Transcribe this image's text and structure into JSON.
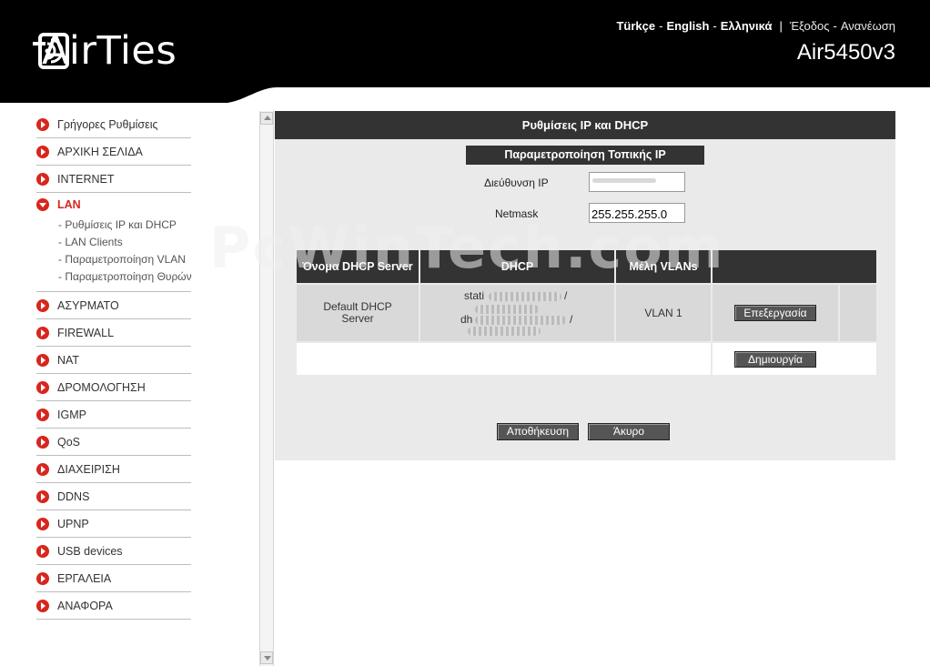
{
  "header": {
    "brand": "AirTies",
    "languages": [
      "Türkçe",
      "English",
      "Ελληνικά"
    ],
    "actions": [
      "Έξοδος",
      "Ανανέωση"
    ],
    "model": "Air5450v3"
  },
  "sidebar": {
    "items": [
      {
        "label": "Γρήγορες Ρυθμίσεις"
      },
      {
        "label": "ΑΡΧΙΚΗ ΣΕΛΙΔΑ"
      },
      {
        "label": "INTERNET"
      },
      {
        "label": "LAN",
        "active": true,
        "subitems": [
          "- Ρυθμίσεις IP και DHCP",
          "- LAN Clients",
          "- Παραμετροποίηση VLAN",
          "- Παραμετροποίηση Θυρών"
        ]
      },
      {
        "label": "ΑΣΥΡΜΑΤΟ"
      },
      {
        "label": "FIREWALL"
      },
      {
        "label": "NAT"
      },
      {
        "label": "ΔΡΟΜΟΛΟΓΗΣΗ"
      },
      {
        "label": "IGMP"
      },
      {
        "label": "QoS"
      },
      {
        "label": "ΔΙΑΧΕΙΡΙΣΗ"
      },
      {
        "label": "DDNS"
      },
      {
        "label": "UPNP"
      },
      {
        "label": "USB devices"
      },
      {
        "label": "ΕΡΓΑΛΕΙΑ"
      },
      {
        "label": "ΑΝΑΦΟΡΑ"
      }
    ]
  },
  "main": {
    "title": "Ρυθμίσεις IP και DHCP",
    "local_ip": {
      "title": "Παραμετροποίηση Τοπικής IP",
      "ip_label": "Διεύθυνση IP",
      "ip_value": "",
      "netmask_label": "Netmask",
      "netmask_value": "255.255.255.0"
    },
    "table": {
      "headers": [
        "Όνομα DHCP Server",
        "DHCP",
        "Μέλη VLANs",
        ""
      ],
      "rows": [
        {
          "name": "Default DHCP Server",
          "dhcp_line1_prefix": "stati",
          "dhcp_line1_suffix": "/",
          "dhcp_line2_prefix": "dh",
          "dhcp_line2_suffix": "/",
          "vlans": "VLAN 1",
          "edit_label": "Επεξεργασία"
        }
      ],
      "create_label": "Δημιουργία"
    },
    "save_label": "Αποθήκευση",
    "cancel_label": "Άκυρο"
  },
  "watermark": "PcWinTech.com",
  "colors": {
    "accent": "#d7261e",
    "header_bg": "#000000",
    "panel_dark": "#333333"
  }
}
